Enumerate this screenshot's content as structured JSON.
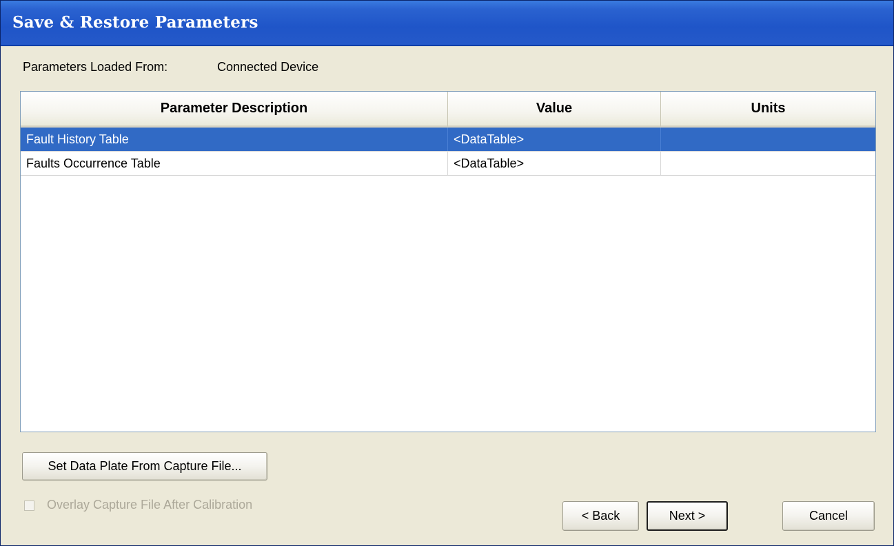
{
  "window": {
    "title": "Save & Restore Parameters"
  },
  "source": {
    "label": "Parameters Loaded From:",
    "value": "Connected Device"
  },
  "table": {
    "columns": [
      "Parameter Description",
      "Value",
      "Units"
    ],
    "rows": [
      {
        "description": "Fault History Table",
        "value": "<DataTable>",
        "units": "",
        "selected": true
      },
      {
        "description": "Faults Occurrence Table",
        "value": "<DataTable>",
        "units": "",
        "selected": false
      }
    ]
  },
  "buttons": {
    "data_plate": "Set Data Plate From Capture File...",
    "back": "< Back",
    "next": "Next >",
    "cancel": "Cancel"
  },
  "overlay_checkbox": {
    "label": "Overlay Capture File After Calibration",
    "checked": false,
    "enabled": false
  },
  "colors": {
    "title_bar": "#2559c9",
    "selection": "#316ac5",
    "window_bg": "#ece9d8"
  }
}
